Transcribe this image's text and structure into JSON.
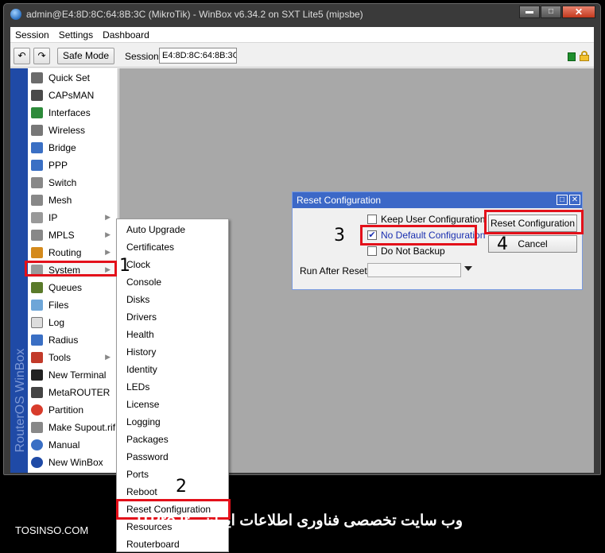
{
  "window": {
    "title": "admin@E4:8D:8C:64:8B:3C (MikroTik) - WinBox v6.34.2 on SXT Lite5 (mipsbe)",
    "min_label": "▬",
    "max_label": "□",
    "close_label": "✕"
  },
  "menubar": {
    "items": [
      "Session",
      "Settings",
      "Dashboard"
    ]
  },
  "toolbar": {
    "undo_label": "↶",
    "redo_label": "↷",
    "safe_mode_label": "Safe Mode",
    "session_label": "Session:",
    "session_value": "E4:8D:8C:64:8B:3C"
  },
  "brand": {
    "text": "RouterOS WinBox"
  },
  "sidebar": {
    "items": [
      {
        "label": "Quick Set",
        "icon": "quick-set-icon",
        "color": "#6b6b6b"
      },
      {
        "label": "CAPsMAN",
        "icon": "capsman-icon",
        "color": "#4a4a4a"
      },
      {
        "label": "Interfaces",
        "icon": "interfaces-icon",
        "color": "#2d8a3a"
      },
      {
        "label": "Wireless",
        "icon": "wireless-icon",
        "color": "#777777"
      },
      {
        "label": "Bridge",
        "icon": "bridge-icon",
        "color": "#3a6fc4"
      },
      {
        "label": "PPP",
        "icon": "ppp-icon",
        "color": "#3a6fc4"
      },
      {
        "label": "Switch",
        "icon": "switch-icon",
        "color": "#888888"
      },
      {
        "label": "Mesh",
        "icon": "mesh-icon",
        "color": "#888888"
      },
      {
        "label": "IP",
        "icon": "ip-icon",
        "color": "#999999",
        "submenu": true
      },
      {
        "label": "MPLS",
        "icon": "mpls-icon",
        "color": "#888888",
        "submenu": true
      },
      {
        "label": "Routing",
        "icon": "routing-icon",
        "color": "#d48a1c",
        "submenu": true
      },
      {
        "label": "System",
        "icon": "system-icon",
        "color": "#999999",
        "submenu": true
      },
      {
        "label": "Queues",
        "icon": "queues-icon",
        "color": "#5a7a2a"
      },
      {
        "label": "Files",
        "icon": "files-icon",
        "color": "#6ea6d8"
      },
      {
        "label": "Log",
        "icon": "log-icon",
        "color": "#dddddd"
      },
      {
        "label": "Radius",
        "icon": "radius-icon",
        "color": "#3a6fc4"
      },
      {
        "label": "Tools",
        "icon": "tools-icon",
        "color": "#c23a2a",
        "submenu": true
      },
      {
        "label": "New Terminal",
        "icon": "terminal-icon",
        "color": "#222222"
      },
      {
        "label": "MetaROUTER",
        "icon": "metarouter-icon",
        "color": "#444444"
      },
      {
        "label": "Partition",
        "icon": "partition-icon",
        "color": "#d83c2c"
      },
      {
        "label": "Make Supout.rif",
        "icon": "supout-icon",
        "color": "#888888"
      },
      {
        "label": "Manual",
        "icon": "manual-icon",
        "color": "#3a6fc4"
      },
      {
        "label": "New WinBox",
        "icon": "new-winbox-icon",
        "color": "#1f4aa6"
      }
    ]
  },
  "system_menu": {
    "items": [
      "Auto Upgrade",
      "Certificates",
      "Clock",
      "Console",
      "Disks",
      "Drivers",
      "Health",
      "History",
      "Identity",
      "LEDs",
      "License",
      "Logging",
      "Packages",
      "Password",
      "Ports",
      "Reboot",
      "Reset Configuration",
      "Resources",
      "Routerboard"
    ]
  },
  "dialog": {
    "title": "Reset Configuration",
    "keep_user_config_label": "Keep User Configuration",
    "keep_user_config_checked": false,
    "no_default_config_label": "No Default Configuration",
    "no_default_config_checked": true,
    "do_not_backup_label": "Do Not Backup",
    "do_not_backup_checked": false,
    "run_after_reset_label": "Run After Reset:",
    "run_after_reset_value": "",
    "reset_button_label": "Reset Configuration",
    "cancel_button_label": "Cancel",
    "check_mark": "✔"
  },
  "annotations": {
    "step1": "1",
    "step2": "2",
    "step3": "3",
    "step4": "4",
    "highlight_color": "#e3101a"
  },
  "footer": {
    "left": "TOSINSO.COM",
    "right": "وب سایت تخصصی فناوری اطلاعات ایران - ITPro.ir"
  }
}
